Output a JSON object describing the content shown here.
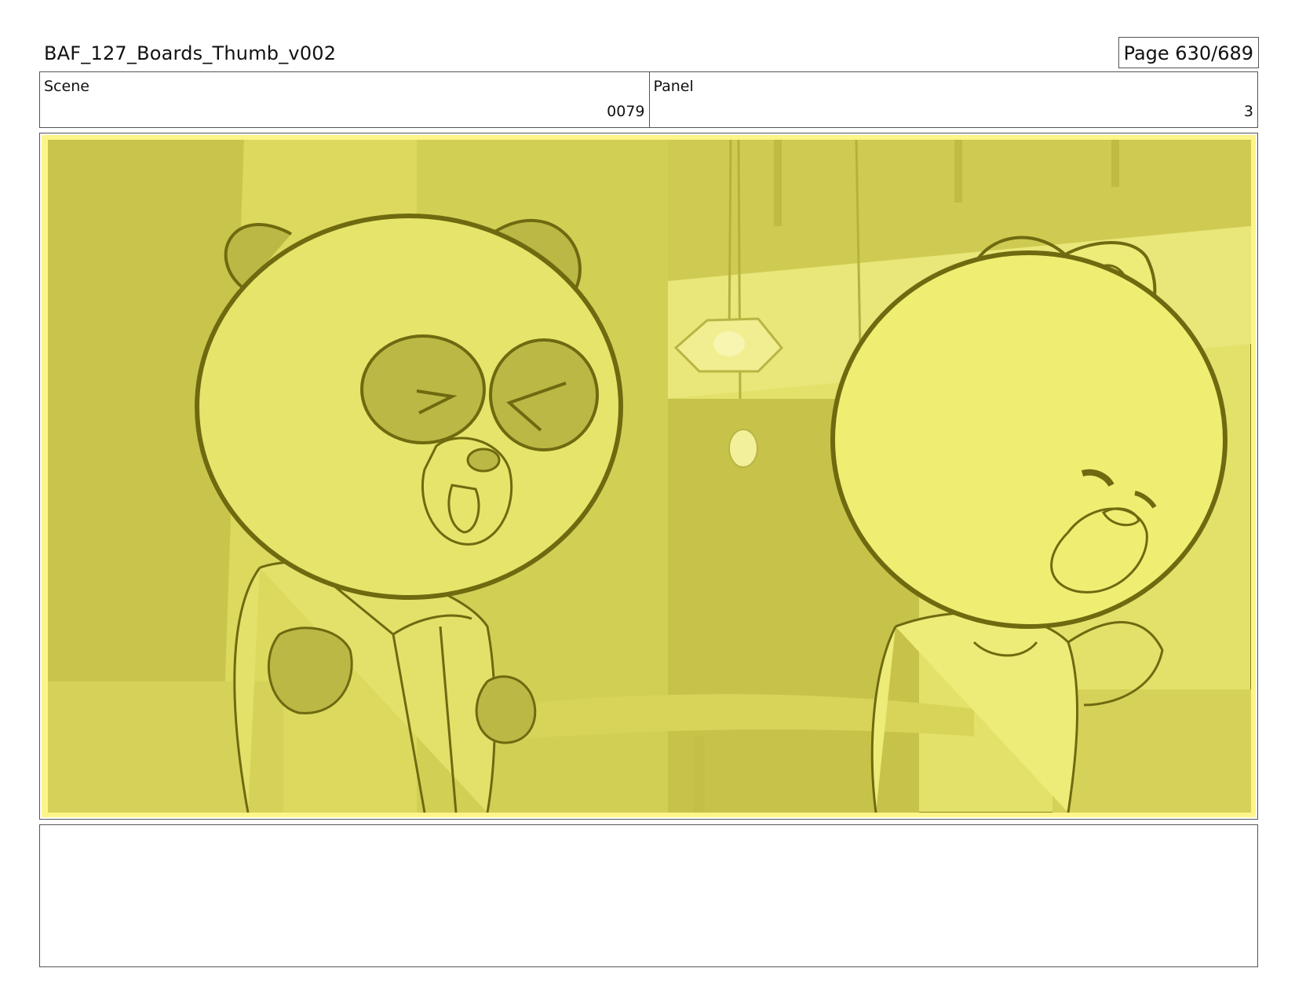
{
  "header": {
    "title": "BAF_127_Boards_Thumb_v002",
    "page_label": "Page 630/689"
  },
  "info": {
    "scene_label": "Scene",
    "scene_value": "0079",
    "panel_label": "Panel",
    "panel_value": "3"
  },
  "frame": {
    "description_icon": "storyboard-sketch-image",
    "tint_color": "#e6e46a",
    "line_color": "#6f6a10"
  },
  "notes": {
    "text": ""
  }
}
